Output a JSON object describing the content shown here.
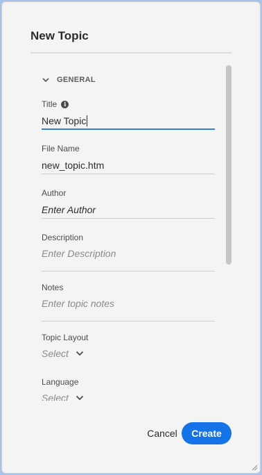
{
  "dialog": {
    "title": "New Topic",
    "section_label": "GENERAL",
    "fields": {
      "title": {
        "label": "Title",
        "value": "New Topic"
      },
      "file_name": {
        "label": "File Name",
        "value": "new_topic.htm"
      },
      "author": {
        "label": "Author",
        "placeholder": "Enter Author"
      },
      "description": {
        "label": "Description",
        "placeholder": "Enter Description"
      },
      "notes": {
        "label": "Notes",
        "placeholder": "Enter topic notes"
      },
      "topic_layout": {
        "label": "Topic Layout",
        "selected": "Select"
      },
      "language": {
        "label": "Language",
        "selected": "Select"
      }
    },
    "buttons": {
      "cancel": "Cancel",
      "create": "Create"
    }
  },
  "colors": {
    "accent": "#1473e6",
    "focus_underline": "#2f7ddc",
    "dialog_bg": "#f4f4f4",
    "backdrop": "#a9c2ea"
  },
  "icons": [
    "chevron-down-icon",
    "info-icon",
    "resize-handle-icon"
  ]
}
